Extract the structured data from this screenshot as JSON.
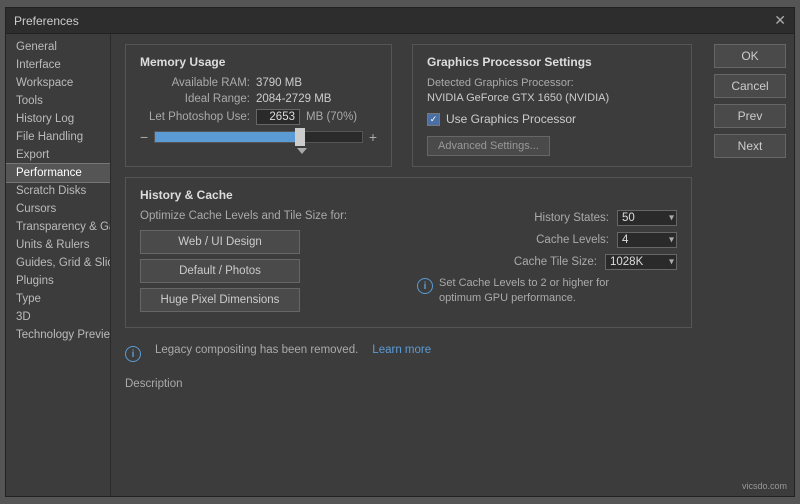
{
  "dialog": {
    "title": "Preferences",
    "close_label": "✕"
  },
  "sidebar": {
    "items": [
      {
        "label": "General"
      },
      {
        "label": "Interface"
      },
      {
        "label": "Workspace"
      },
      {
        "label": "Tools"
      },
      {
        "label": "History Log"
      },
      {
        "label": "File Handling"
      },
      {
        "label": "Export"
      },
      {
        "label": "Performance"
      },
      {
        "label": "Scratch Disks"
      },
      {
        "label": "Cursors"
      },
      {
        "label": "Transparency & Gamut"
      },
      {
        "label": "Units & Rulers"
      },
      {
        "label": "Guides, Grid & Slices"
      },
      {
        "label": "Plugins"
      },
      {
        "label": "Type"
      },
      {
        "label": "3D"
      },
      {
        "label": "Technology Previews"
      }
    ],
    "active_index": 7
  },
  "memory": {
    "section_title": "Memory Usage",
    "available_label": "Available RAM:",
    "available_value": "3790 MB",
    "ideal_label": "Ideal Range:",
    "ideal_value": "2084-2729 MB",
    "let_use_label": "Let Photoshop Use:",
    "let_use_value": "2653",
    "mb_percent": "MB (70%)",
    "slider_minus": "−",
    "slider_plus": "+"
  },
  "gpu": {
    "section_title": "Graphics Processor Settings",
    "detected_label": "Detected Graphics Processor:",
    "detected_value": "NVIDIA GeForce GTX 1650 (NVIDIA)",
    "use_gpu_label": "Use Graphics Processor",
    "adv_settings_label": "Advanced Settings...",
    "info_text": "Set Cache Levels to 2 or higher for\noptimum GPU performance."
  },
  "history_cache": {
    "section_title": "History & Cache",
    "optimize_label": "Optimize Cache Levels and Tile Size for:",
    "btn1": "Web / UI Design",
    "btn2": "Default / Photos",
    "btn3": "Huge Pixel Dimensions",
    "history_states_label": "History States:",
    "history_states_value": "50",
    "cache_levels_label": "Cache Levels:",
    "cache_levels_value": "4",
    "cache_tile_label": "Cache Tile Size:",
    "cache_tile_value": "1028K"
  },
  "legacy": {
    "info_text": "Legacy compositing has been removed.",
    "learn_more": "Learn more"
  },
  "description": {
    "label": "Description"
  },
  "buttons": {
    "ok": "OK",
    "cancel": "Cancel",
    "prev": "Prev",
    "next": "Next"
  },
  "watermark": "vicsdo.com"
}
